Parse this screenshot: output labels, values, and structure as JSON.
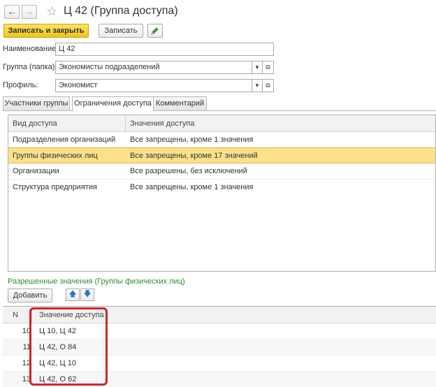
{
  "window": {
    "title": "Ц 42 (Группа доступа)",
    "back_icon": "arrow-left-icon",
    "forward_icon": "arrow-right-icon",
    "favorite_icon": "star-icon"
  },
  "toolbar": {
    "save_close_label": "Записать и закрыть",
    "save_label": "Записать",
    "edit_icon": "pencil-icon"
  },
  "fields": {
    "name_label": "Наименование:",
    "name_value": "Ц 42",
    "group_label": "Группа (папка):",
    "group_value": "Экономисты подразделений",
    "profile_label": "Профиль:",
    "profile_value": "Экономист"
  },
  "tabs": [
    {
      "label": "Участники группы",
      "active": false
    },
    {
      "label": "Ограничения доступа",
      "active": true
    },
    {
      "label": "Комментарий",
      "active": false
    }
  ],
  "access_table": {
    "columns": [
      "Вид доступа",
      "Значения доступа"
    ],
    "rows": [
      {
        "kind": "Подразделения организаций",
        "values": "Все запрещены, кроме 1 значения",
        "selected": false
      },
      {
        "kind": "Группы физических лиц",
        "values": "Все запрещены, кроме 17 значений",
        "selected": true
      },
      {
        "kind": "Организации",
        "values": "Все разрешены, без исключений",
        "selected": false
      },
      {
        "kind": "Структура предприятия",
        "values": "Все запрещены, кроме 1 значения",
        "selected": false
      }
    ]
  },
  "allowed_section": {
    "title": "Разрешенные значения (Группы физических лиц)",
    "add_label": "Добавить",
    "up_icon": "arrow-up-icon",
    "down_icon": "arrow-down-icon",
    "columns": [
      "N",
      "Значение доступа"
    ],
    "rows": [
      {
        "n": "10",
        "value": "Ц 10, Ц 42"
      },
      {
        "n": "11",
        "value": "Ц 42, О 84"
      },
      {
        "n": "12",
        "value": "Ц 42, Ц 10"
      },
      {
        "n": "13",
        "value": "Ц 42, О 62"
      }
    ]
  },
  "colors": {
    "primary_button": "#f3c41a",
    "selected_row": "#fde18a",
    "section_label": "#2f8c2f",
    "highlight_box": "#d0262b"
  }
}
